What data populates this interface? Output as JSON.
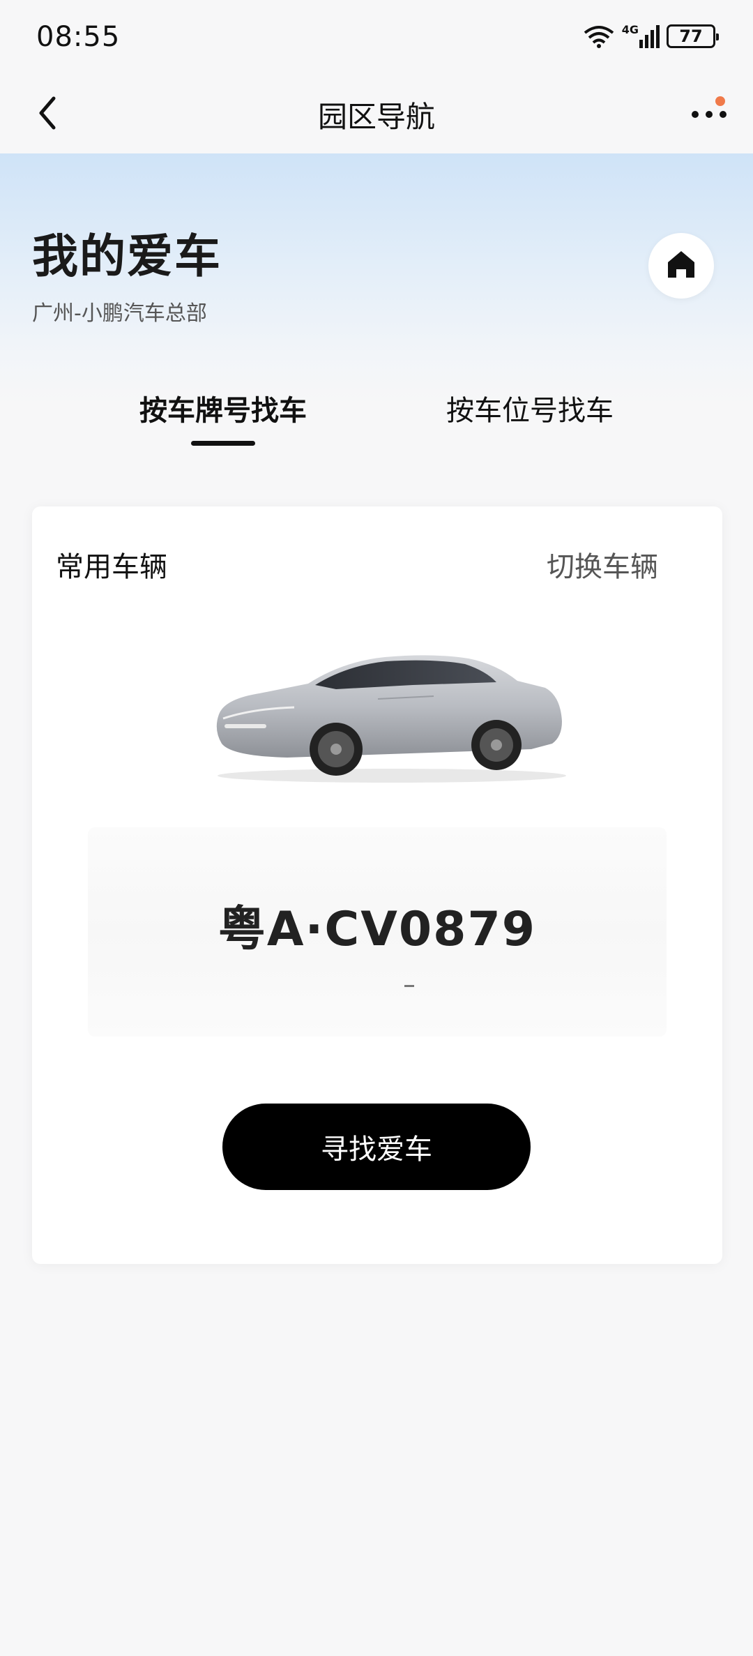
{
  "status_bar": {
    "time": "08:55",
    "network_label": "4G",
    "battery": "77"
  },
  "header": {
    "title": "园区导航",
    "back_icon": "chevron-left-icon",
    "more_icon": "more-horizontal-icon",
    "notification_dot_color": "#f07a4a"
  },
  "hero": {
    "title": "我的爱车",
    "subtitle": "广州-小鹏汽车总部",
    "home_icon": "home-icon"
  },
  "tabs": [
    {
      "label": "按车牌号找车",
      "active": true
    },
    {
      "label": "按车位号找车",
      "active": false
    }
  ],
  "card": {
    "label": "常用车辆",
    "switch_label": "切换车辆",
    "plate_number": "粤A·CV0879",
    "find_button_label": "寻找爱车"
  },
  "colors": {
    "accent": "#000000",
    "hero_gradient_top": "#cfe3f7",
    "background": "#f7f7f8"
  }
}
